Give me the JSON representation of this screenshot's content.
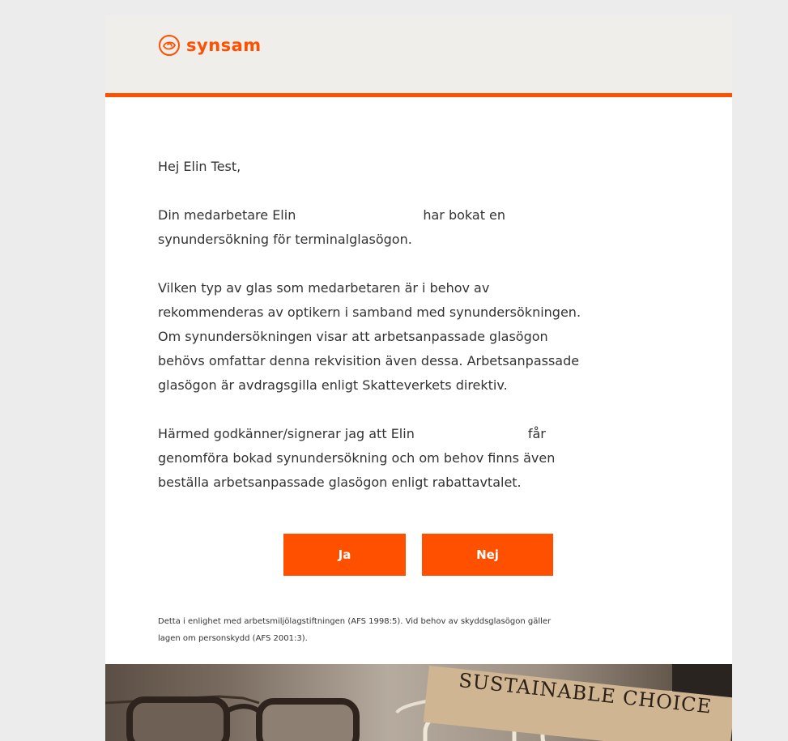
{
  "brand": {
    "name": "synsam",
    "logo_icon": "synsam-eye-logo-icon",
    "color": "#ff5000"
  },
  "email": {
    "greeting": "Hej Elin Test,",
    "p1_a": "Din medarbetare Elin",
    "p1_b": "har bokat en",
    "p1_c": "synundersökning för terminalglasögon.",
    "p2_l1": "Vilken typ av glas som medarbetaren är i behov av",
    "p2_l2": "rekommenderas av optikern i samband med synundersökningen.",
    "p2_l3": "Om synundersökningen visar att arbetsanpassade glasögon",
    "p2_l4": "behövs omfattar denna rekvisition även dessa. Arbetsanpassade",
    "p2_l5": "glasögon är avdragsgilla enligt Skatteverkets direktiv.",
    "p3_a": "Härmed godkänner/signerar jag att Elin",
    "p3_b": "får",
    "p3_l2": "genomföra bokad synundersökning och om behov finns även",
    "p3_l3": "beställa arbetsanpassade glasögon enligt rabattavtalet.",
    "yes_label": "Ja",
    "no_label": "Nej",
    "footnote_l1": "Detta i enlighet med arbetsmiljölagstiftningen (AFS 1998:5). Vid behov av skyddsglasögon gäller",
    "footnote_l2": "lagen om personskydd (AFS 2001:3)."
  },
  "banner": {
    "text": "SUSTAINABLE CHOICE"
  }
}
